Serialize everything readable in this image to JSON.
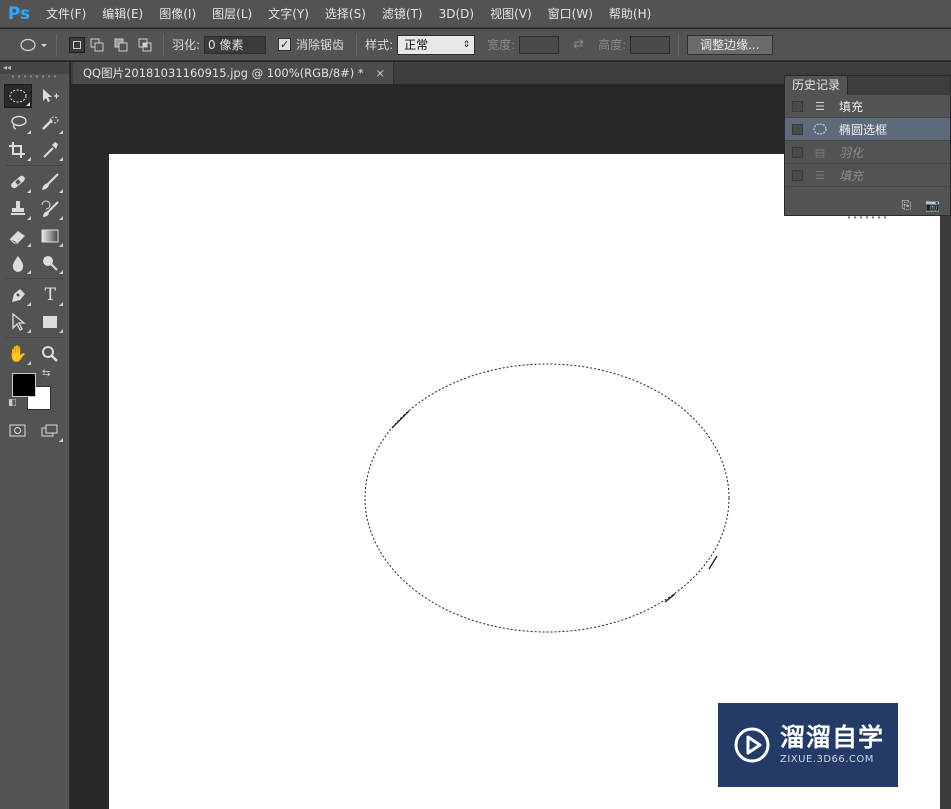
{
  "app": {
    "logo": "Ps",
    "accent": "#31a8ff"
  },
  "menu": {
    "items": [
      "文件(F)",
      "编辑(E)",
      "图像(I)",
      "图层(L)",
      "文字(Y)",
      "选择(S)",
      "滤镜(T)",
      "3D(D)",
      "视图(V)",
      "窗口(W)",
      "帮助(H)"
    ]
  },
  "options": {
    "feather_label": "羽化:",
    "feather_value": "0 像素",
    "antialias_label": "消除锯齿",
    "antialias_checked": true,
    "style_label": "样式:",
    "style_value": "正常",
    "width_label": "宽度:",
    "height_label": "高度:",
    "refine_edge_button": "调整边缘..."
  },
  "document": {
    "tab_title": "QQ图片20181031160915.jpg @ 100%(RGB/8#) *",
    "tab_close": "×"
  },
  "toolbar": {
    "collapse_glyph": "◂◂",
    "colors": {
      "foreground": "#000000",
      "background": "#ffffff"
    }
  },
  "history": {
    "panel_title": "历史记录",
    "items": [
      {
        "label": "填充",
        "icon": "fill-step-icon",
        "state": "normal"
      },
      {
        "label": "椭圆选框",
        "icon": "ellipse-step-icon",
        "state": "selected"
      },
      {
        "label": "羽化",
        "icon": "feather-step-icon",
        "state": "undone"
      },
      {
        "label": "填充",
        "icon": "fill-step-icon",
        "state": "undone"
      }
    ]
  },
  "watermark": {
    "title": "溜溜自学",
    "subtitle": "ZIXUE.3D66.COM",
    "color": "#233b66"
  }
}
